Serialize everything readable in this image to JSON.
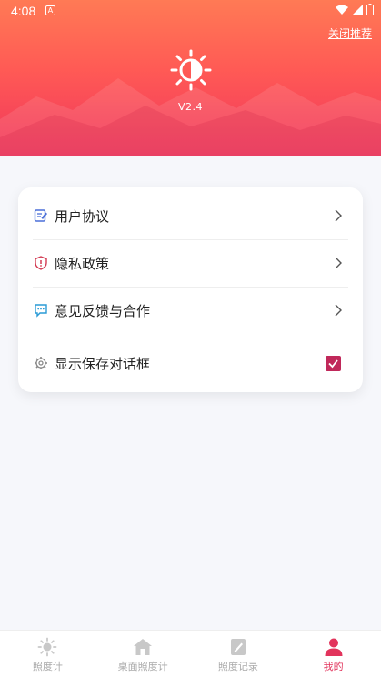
{
  "status_bar": {
    "time": "4:08",
    "notif_glyph": "A"
  },
  "header": {
    "close_recommend": "关闭推荐",
    "version": "V2.4",
    "logo_icon": "sun-contrast-icon"
  },
  "settings": {
    "items": [
      {
        "label": "用户协议",
        "icon": "agreement-icon"
      },
      {
        "label": "隐私政策",
        "icon": "shield-icon"
      },
      {
        "label": "意见反馈与合作",
        "icon": "chat-icon"
      },
      {
        "label": "显示保存对话框",
        "icon": "gear-icon",
        "checked": true
      }
    ]
  },
  "tabbar": {
    "tabs": [
      {
        "label": "照度计",
        "icon": "sun-icon",
        "active": false
      },
      {
        "label": "桌面照度计",
        "icon": "home-icon",
        "active": false
      },
      {
        "label": "照度记录",
        "icon": "record-icon",
        "active": false
      },
      {
        "label": "我的",
        "icon": "user-icon",
        "active": true
      }
    ]
  },
  "colors": {
    "accent": "#e2345c",
    "checkbox": "#c0285a",
    "header_top": "#ff7a55",
    "header_bottom": "#f0365c"
  }
}
